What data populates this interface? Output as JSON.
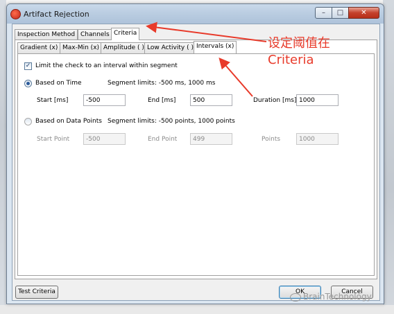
{
  "window": {
    "title": "Artifact Rejection"
  },
  "outer_tabs": [
    {
      "label": "Inspection Method"
    },
    {
      "label": "Channels"
    },
    {
      "label": "Criteria"
    }
  ],
  "inner_tabs": [
    {
      "label": "Gradient (x)"
    },
    {
      "label": "Max-Min (x)"
    },
    {
      "label": "Amplitude ( )"
    },
    {
      "label": "Low Activity ( )"
    },
    {
      "label": "Intervals (x)"
    }
  ],
  "intervals": {
    "limit_check_label": "Limit the check to an interval within segment",
    "limit_checked": true,
    "time": {
      "label": "Based on Time",
      "selected": true,
      "limits": "Segment limits: -500 ms, 1000 ms",
      "start_label": "Start [ms]",
      "start_value": "-500",
      "end_label": "End [ms]",
      "end_value": "500",
      "duration_label": "Duration [ms]",
      "duration_value": "1000"
    },
    "points": {
      "label": "Based on Data Points",
      "selected": false,
      "limits": "Segment limits: -500 points, 1000 points",
      "start_label": "Start Point",
      "start_value": "-500",
      "end_label": "End Point",
      "end_value": "499",
      "count_label": "Points",
      "count_value": "1000"
    }
  },
  "footer": {
    "test_label": "Test Criteria",
    "ok_label": "OK",
    "cancel_label": "Cancel"
  },
  "annotation": {
    "line1": "设定阈值在",
    "line2": "Criteria",
    "color": "#e83a2a"
  },
  "watermark": {
    "text": "BrainTechnology"
  }
}
